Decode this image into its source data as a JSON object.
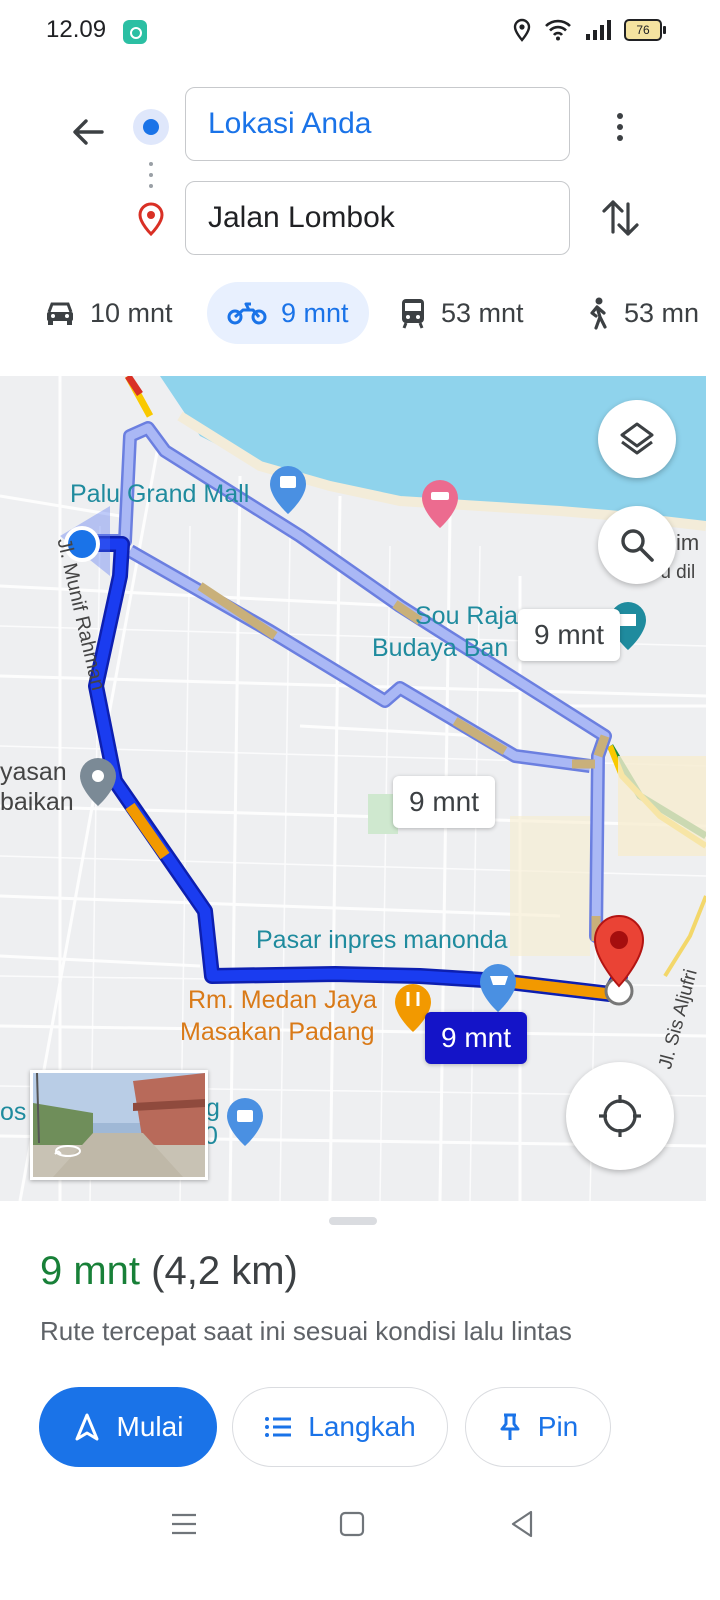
{
  "status_bar": {
    "time": "12.09",
    "battery": "76",
    "icons": [
      "location-icon",
      "wifi-icon",
      "signal-icon",
      "battery-icon"
    ]
  },
  "directions": {
    "origin": "Lokasi Anda",
    "destination": "Jalan Lombok",
    "modes": [
      {
        "icon": "car-icon",
        "label": "10 mnt",
        "active": false
      },
      {
        "icon": "motorcycle-icon",
        "label": "9 mnt",
        "active": true
      },
      {
        "icon": "transit-icon",
        "label": "53 mnt",
        "active": false
      },
      {
        "icon": "walk-icon",
        "label": "53 mn",
        "active": false
      }
    ]
  },
  "map": {
    "labels": {
      "palu_grand_mall": "Palu Grand Mall",
      "sou_raja_1": "Sou Raja",
      "sou_raja_2": "Budaya Ban",
      "street_jl_munif": "Jl. Munif Rahman",
      "yayasan_1": "yasan",
      "yayasan_2": "baikan",
      "pasar": "Pasar inpres manonda",
      "rm_medan_1": "Rm. Medan Jaya",
      "rm_medan_2": "Masakan Padang",
      "street_sis": "Jl. Sis Aljufri",
      "partial_right_1": "im",
      "partial_right_2": "ru dil",
      "partial_left": "os",
      "partial_g": "g",
      "partial_zero": "0"
    },
    "route_times": {
      "alt1": "9 mnt",
      "alt2": "9 mnt",
      "main": "9 mnt"
    },
    "colors": {
      "route_main": "#1a3cf0",
      "route_alt": "#aab8f5",
      "traffic": "#f29900",
      "water": "#8fd3ec"
    }
  },
  "sheet": {
    "duration": "9 mnt",
    "distance": "(4,2 km)",
    "description": "Rute tercepat saat ini sesuai kondisi lalu lintas",
    "start_label": "Mulai",
    "steps_label": "Langkah",
    "pin_label": "Pin"
  }
}
